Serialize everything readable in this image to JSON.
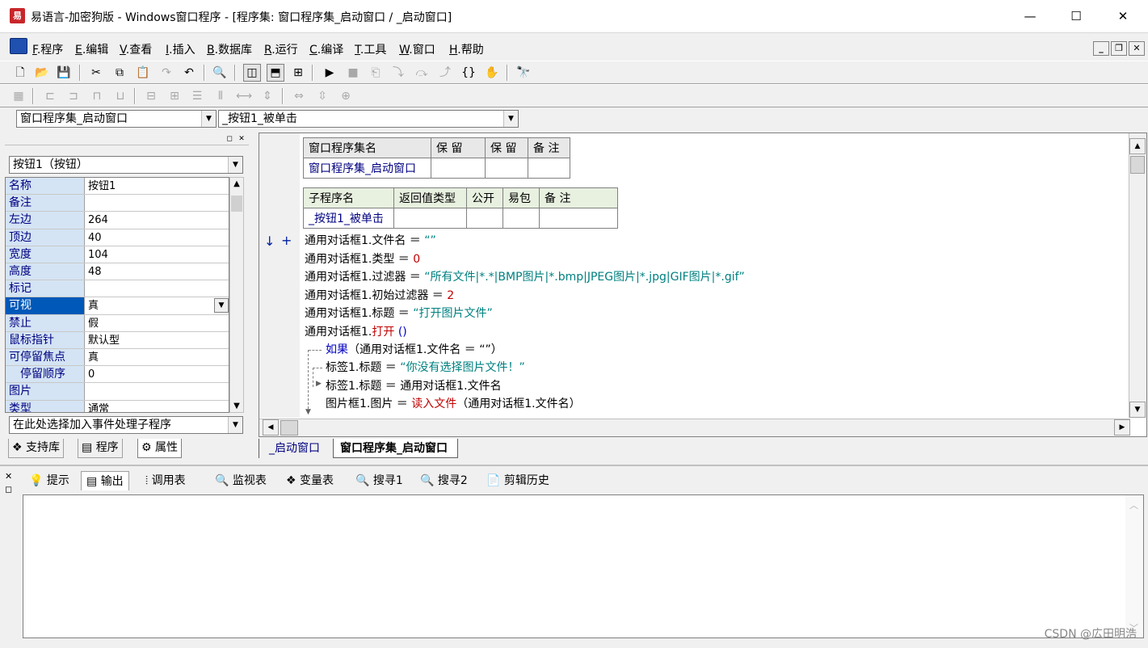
{
  "window": {
    "title": "易语言-加密狗版 - Windows窗口程序 - [程序集: 窗口程序集_启动窗口 / _启动窗口]",
    "app_icon_label": "易",
    "controls": {
      "minimize": "—",
      "maximize": "☐",
      "close": "✕"
    }
  },
  "menubar": {
    "items": [
      {
        "key": "F",
        "label": ".程序"
      },
      {
        "key": "E",
        "label": ".编辑"
      },
      {
        "key": "V",
        "label": ".查看"
      },
      {
        "key": "I",
        "label": ".插入"
      },
      {
        "key": "B",
        "label": ".数据库"
      },
      {
        "key": "R",
        "label": ".运行"
      },
      {
        "key": "C",
        "label": ".编译"
      },
      {
        "key": "T",
        "label": ".工具"
      },
      {
        "key": "W",
        "label": ".窗口"
      },
      {
        "key": "H",
        "label": ".帮助"
      }
    ],
    "mdi": {
      "minimize": "_",
      "restore": "❐",
      "close": "✕"
    }
  },
  "toolbar1": {
    "icons": [
      "new-file-icon",
      "open-folder-icon",
      "save-icon",
      "cut-icon",
      "copy-icon",
      "paste-icon",
      "redo-icon",
      "undo-icon",
      "find-icon",
      "layout-left-icon",
      "layout-top-icon",
      "layout-split-icon",
      "run-icon",
      "stop-icon",
      "step-icon",
      "step-into-icon",
      "step-over-icon",
      "step-out-icon",
      "breakpoint-icon",
      "hand-icon",
      "search-help-icon"
    ]
  },
  "combos": {
    "assembly": "窗口程序集_启动窗口",
    "subroutine": "_按钮1_被单击"
  },
  "left_panel": {
    "object_combo": "按钮1（按钮）",
    "properties": [
      {
        "name": "名称",
        "value": "按钮1"
      },
      {
        "name": "备注",
        "value": ""
      },
      {
        "name": "左边",
        "value": "264"
      },
      {
        "name": "顶边",
        "value": "40"
      },
      {
        "name": "宽度",
        "value": "104"
      },
      {
        "name": "高度",
        "value": "48"
      },
      {
        "name": "标记",
        "value": ""
      },
      {
        "name": "可视",
        "value": "真"
      },
      {
        "name": "禁止",
        "value": "假"
      },
      {
        "name": "鼠标指针",
        "value": "默认型"
      },
      {
        "name": "可停留焦点",
        "value": "真"
      },
      {
        "name": "　停留顺序",
        "value": "0"
      },
      {
        "name": "图片",
        "value": ""
      },
      {
        "name": "类型",
        "value": "通常"
      }
    ],
    "event_combo": "在此处选择加入事件处理子程序",
    "tabs": [
      "支持库",
      "程序",
      "属性"
    ]
  },
  "editor": {
    "assembly_table": {
      "headers": [
        "窗口程序集名",
        "保 留",
        "保 留",
        "备 注"
      ],
      "row": [
        "窗口程序集_启动窗口",
        "",
        "",
        ""
      ]
    },
    "sub_table": {
      "headers": [
        "子程序名",
        "返回值类型",
        "公开",
        "易包",
        "备 注"
      ],
      "row": [
        "_按钮1_被单击",
        "",
        "",
        "",
        ""
      ]
    },
    "gutter_marks": [
      "↓",
      "+"
    ],
    "lines": [
      {
        "obj": "通用对话框1.",
        "prop": "文件名",
        "op": " ＝ ",
        "val": "“”",
        "kind": "str"
      },
      {
        "obj": "通用对话框1.",
        "prop": "类型",
        "op": " ＝ ",
        "val": "0",
        "kind": "num"
      },
      {
        "obj": "通用对话框1.",
        "prop": "过滤器",
        "op": " ＝ ",
        "val": "“所有文件|*.*|BMP图片|*.bmp|JPEG图片|*.jpg|GIF图片|*.gif”",
        "kind": "str"
      },
      {
        "obj": "通用对话框1.",
        "prop": "初始过滤器",
        "op": " ＝ ",
        "val": "2",
        "kind": "num"
      },
      {
        "obj": "通用对话框1.",
        "prop": "标题",
        "op": " ＝ ",
        "val": "“打开图片文件”",
        "kind": "str"
      },
      {
        "obj": "通用对话框1.",
        "prop": "打开",
        "op": " ",
        "val": "()",
        "kind": "call"
      }
    ],
    "if_line": {
      "kw": "如果",
      "rest": "（通用对话框1.文件名 ＝ “”）"
    },
    "then_line": {
      "lhs": "标签1.标题",
      "op": " ＝ ",
      "val": "“你没有选择图片文件！”"
    },
    "else_line": {
      "text": "标签1.标题 ＝ 通用对话框1.文件名"
    },
    "after_line": {
      "lhs": "图片框1.图片",
      "op": " ＝ ",
      "fn": "读入文件",
      "rest": "（通用对话框1.文件名）"
    },
    "tabs": [
      "_启动窗口",
      "窗口程序集_启动窗口"
    ]
  },
  "bottom_panel": {
    "tabs": [
      "提示",
      "输出",
      "调用表",
      "监视表",
      "变量表",
      "搜寻1",
      "搜寻2",
      "剪辑历史"
    ],
    "tab_icons": [
      "hint-icon",
      "output-icon",
      "callstack-icon",
      "watch-icon",
      "variables-icon",
      "search1-icon",
      "search2-icon",
      "clip-history-icon"
    ]
  },
  "watermark": "CSDN @広田明浩"
}
